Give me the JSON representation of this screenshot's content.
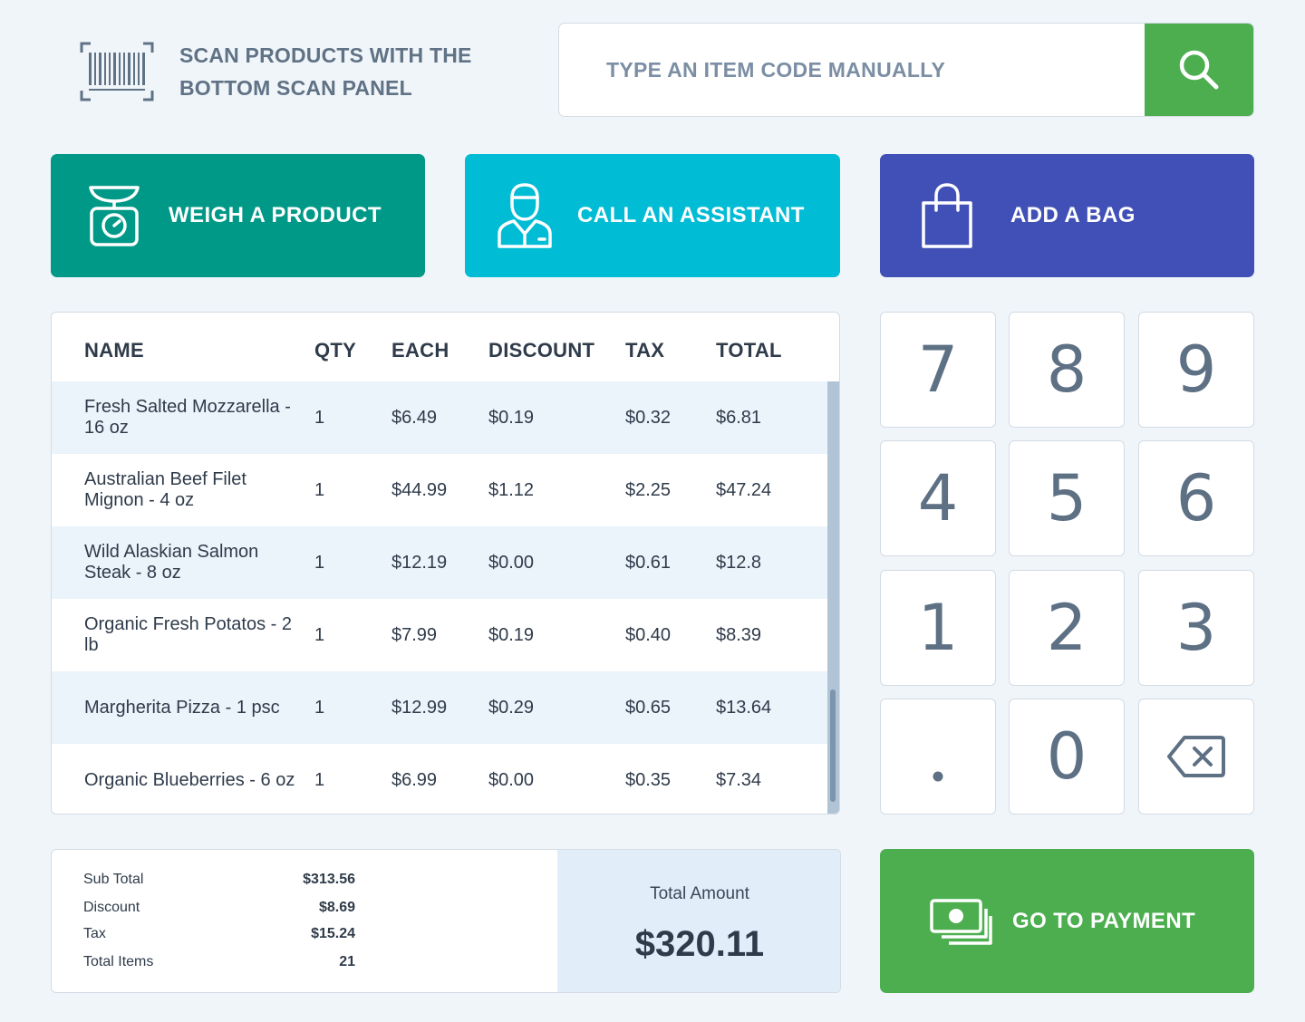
{
  "header": {
    "scan_hint_line1": "SCAN PRODUCTS WITH THE",
    "scan_hint_line2": "BOTTOM SCAN PANEL",
    "search_placeholder": "TYPE AN ITEM CODE MANUALLY"
  },
  "actions": {
    "weigh_label": "WEIGH A PRODUCT",
    "assistant_label": "CALL AN ASSISTANT",
    "bag_label": "ADD A BAG"
  },
  "table": {
    "headers": {
      "name": "NAME",
      "qty": "QTY",
      "each": "EACH",
      "discount": "DISCOUNT",
      "tax": "TAX",
      "total": "TOTAL"
    },
    "rows": [
      {
        "name": "Fresh Salted Mozzarella - 16 oz",
        "qty": "1",
        "each": "$6.49",
        "discount": "$0.19",
        "tax": "$0.32",
        "total": "$6.81"
      },
      {
        "name": "Australian Beef Filet Mignon - 4 oz",
        "qty": "1",
        "each": "$44.99",
        "discount": "$1.12",
        "tax": "$2.25",
        "total": "$47.24"
      },
      {
        "name": "Wild Alaskian Salmon Steak - 8 oz",
        "qty": "1",
        "each": "$12.19",
        "discount": "$0.00",
        "tax": "$0.61",
        "total": "$12.8"
      },
      {
        "name": "Organic Fresh Potatos - 2 lb",
        "qty": "1",
        "each": "$7.99",
        "discount": "$0.19",
        "tax": "$0.40",
        "total": "$8.39"
      },
      {
        "name": "Margherita Pizza - 1 psc",
        "qty": "1",
        "each": "$12.99",
        "discount": "$0.29",
        "tax": "$0.65",
        "total": "$13.64"
      },
      {
        "name": "Organic Blueberries - 6 oz",
        "qty": "1",
        "each": "$6.99",
        "discount": "$0.00",
        "tax": "$0.35",
        "total": "$7.34"
      }
    ]
  },
  "keypad": {
    "keys": [
      "7",
      "8",
      "9",
      "4",
      "5",
      "6",
      "1",
      "2",
      "3",
      ".",
      "0",
      "backspace"
    ]
  },
  "summary": {
    "subtotal_label": "Sub Total",
    "subtotal_value": "$313.56",
    "discount_label": "Discount",
    "discount_value": "$8.69",
    "tax_label": "Tax",
    "tax_value": "$15.24",
    "items_label": "Total Items",
    "items_value": "21",
    "total_label": "Total Amount",
    "total_value": "$320.11"
  },
  "payment": {
    "label": "GO TO PAYMENT"
  },
  "colors": {
    "weigh": "#009886",
    "assistant": "#00bcd4",
    "bag": "#4150b6",
    "green": "#4cae4f"
  }
}
